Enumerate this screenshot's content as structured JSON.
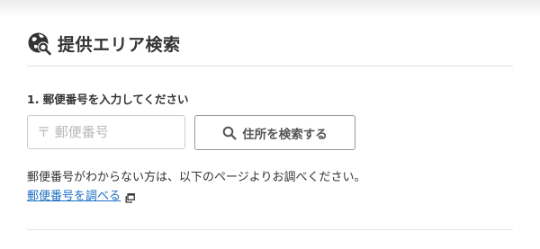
{
  "section": {
    "title": "提供エリア検索",
    "icon": "globe-search-icon"
  },
  "form": {
    "step_label": "1. 郵便番号を入力してください",
    "postal_placeholder": "〒 郵便番号",
    "postal_value": "",
    "search_button_label": "住所を検索する",
    "search_button_icon": "search-icon"
  },
  "help": {
    "text": "郵便番号がわからない方は、以下のページよりお調べください。",
    "link_label": "郵便番号を調べる",
    "link_icon": "external-window-icon"
  },
  "colors": {
    "link": "#1a6fc4",
    "text": "#333333",
    "border": "#cccccc"
  }
}
